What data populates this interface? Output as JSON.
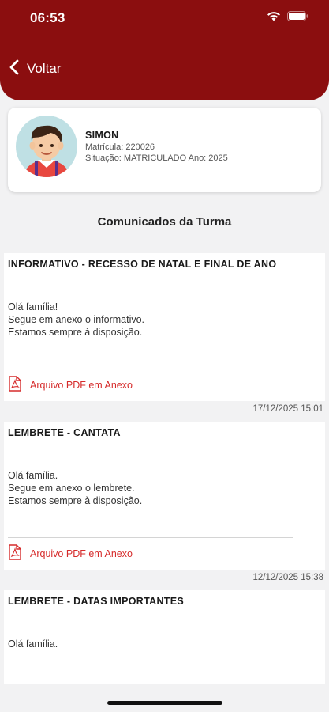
{
  "status_bar": {
    "time": "06:53"
  },
  "header": {
    "back_label": "Voltar"
  },
  "student": {
    "name": "SIMON",
    "matricula": "Matrícula: 220026",
    "situacao": "Situação: MATRICULADO Ano: 2025"
  },
  "section_title": "Comunicados da Turma",
  "posts": [
    {
      "title": "INFORMATIVO - RECESSO DE NATAL E FINAL DE ANO",
      "body": "Olá família!\nSegue em anexo o informativo.\nEstamos sempre à disposição.",
      "attachment": "Arquivo PDF em Anexo",
      "date": "17/12/2025 15:01"
    },
    {
      "title": "LEMBRETE - CANTATA",
      "body": "Olá família.\nSegue em anexo o lembrete.\nEstamos sempre à disposição.",
      "attachment": "Arquivo PDF em Anexo",
      "date": "12/12/2025 15:38"
    },
    {
      "title": "LEMBRETE - DATAS IMPORTANTES",
      "body": "Olá família."
    }
  ],
  "colors": {
    "header": "#8b0e0f",
    "attachment": "#d62b2b",
    "background": "#f2f2f3"
  },
  "icons": [
    "wifi-icon",
    "battery-icon",
    "back-chevron-icon",
    "pdf-icon",
    "avatar"
  ]
}
